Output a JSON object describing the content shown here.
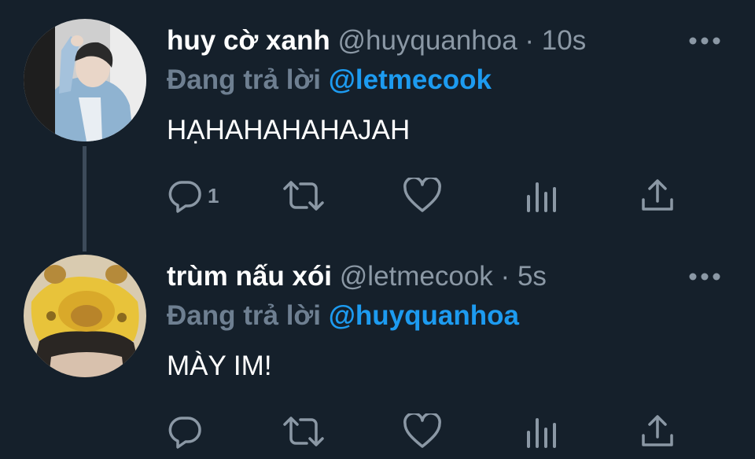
{
  "tweets": [
    {
      "display_name": "huy cờ xanh",
      "handle": "@huyquanhoa",
      "separator": "·",
      "time": "10s",
      "reply_prefix": "Đang trả lời",
      "reply_to": "@letmecook",
      "text": "HẠHAHAHAHAJAH",
      "reply_count": "1",
      "avatar_icon": "profile-photo-denim-jacket"
    },
    {
      "display_name": "trùm nấu xói",
      "handle": "@letmecook",
      "separator": "·",
      "time": "5s",
      "reply_prefix": "Đang trả lời",
      "reply_to": "@huyquanhoa",
      "text": "MÀY IM!",
      "reply_count": "",
      "avatar_icon": "profile-photo-giraffe-hat"
    }
  ],
  "colors": {
    "background": "#15202b",
    "secondary_text": "#8b98a5",
    "mention": "#1d9bf0",
    "thread_line": "#3d4b5a"
  },
  "icons": [
    "reply-icon",
    "retweet-icon",
    "like-icon",
    "analytics-icon",
    "share-icon",
    "more-icon"
  ]
}
